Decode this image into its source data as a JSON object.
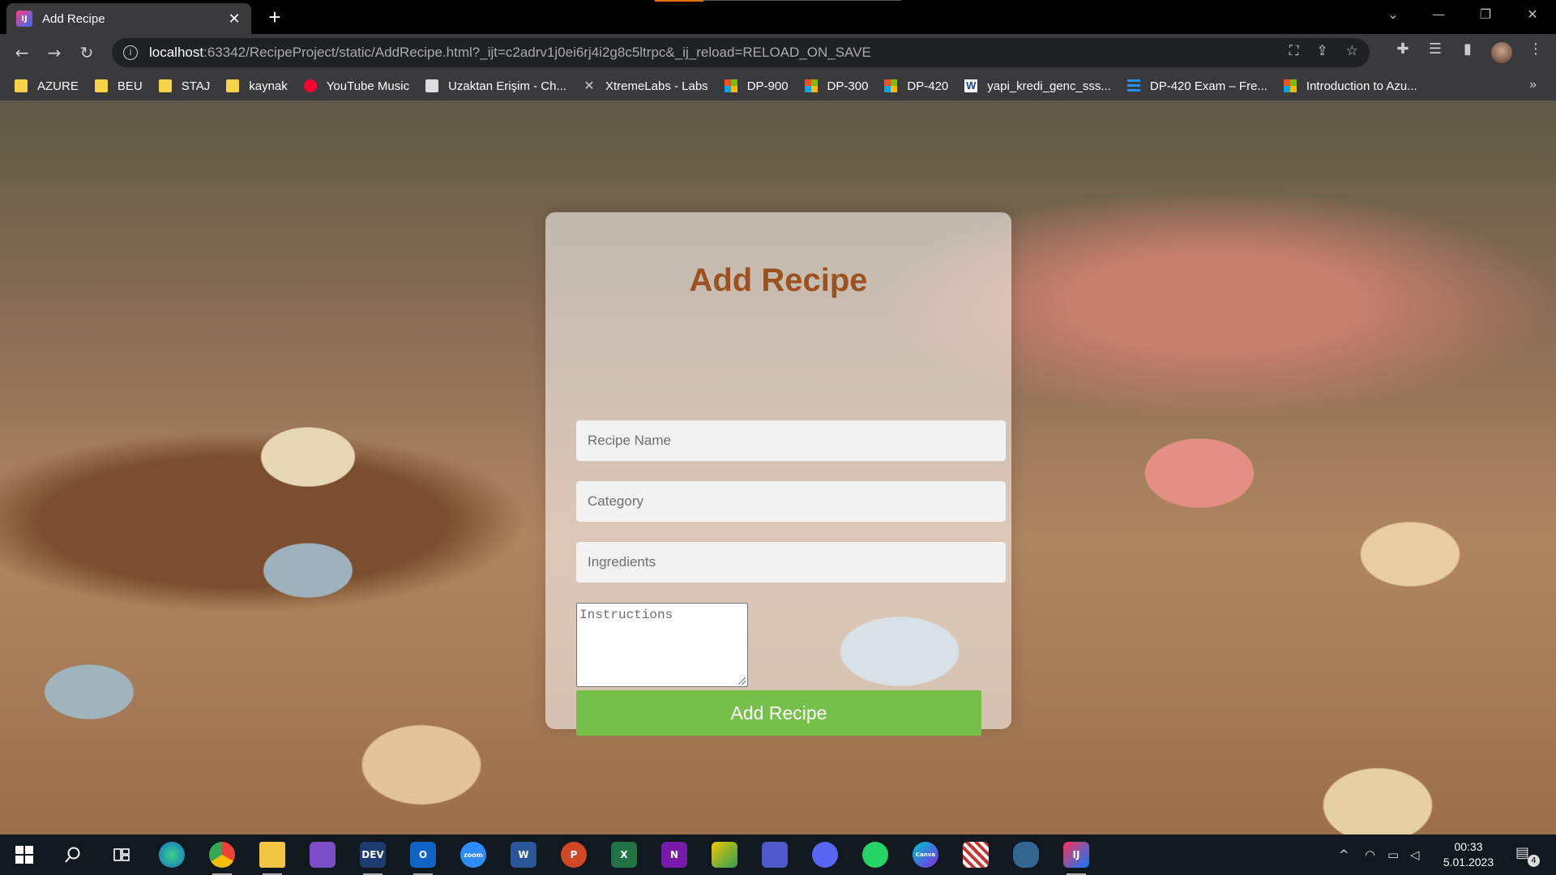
{
  "browser": {
    "tab": {
      "title": "Add Recipe",
      "favicon": "IJ",
      "close": "✕"
    },
    "new_tab": "+",
    "window_controls": {
      "dropdown": "⌄",
      "minimize": "—",
      "restore": "❐",
      "close": "✕"
    },
    "nav": {
      "back": "←",
      "forward": "→",
      "reload": "↻"
    },
    "url": {
      "host": "localhost",
      "rest": ":63342/RecipeProject/static/AddRecipe.html?_ijt=c2adrv1j0ei6rj4i2g8c5ltrpc&_ij_reload=RELOAD_ON_SAVE"
    },
    "omnibox_icons": {
      "translate": "⛶",
      "share": "⇪",
      "bookmark": "☆"
    },
    "toolbar_icons": {
      "extensions": "✚",
      "media": "☰",
      "sidepanel": "▮",
      "menu": "⋮"
    },
    "bookmarks": [
      {
        "label": "AZURE",
        "icon": "folder-icon"
      },
      {
        "label": "BEU",
        "icon": "folder-icon"
      },
      {
        "label": "STAJ",
        "icon": "folder-icon"
      },
      {
        "label": "kaynak",
        "icon": "folder-icon"
      },
      {
        "label": "YouTube Music",
        "icon": "youtube-music-icon"
      },
      {
        "label": "Uzaktan Erişim - Ch...",
        "icon": "remote-desktop-icon"
      },
      {
        "label": "XtremeLabs - Labs",
        "icon": "xtremelabs-icon"
      },
      {
        "label": "DP-900",
        "icon": "microsoft-icon"
      },
      {
        "label": "DP-300",
        "icon": "microsoft-icon"
      },
      {
        "label": "DP-420",
        "icon": "microsoft-icon"
      },
      {
        "label": "yapi_kredi_genc_sss...",
        "icon": "word-icon"
      },
      {
        "label": "DP-420 Exam – Fre...",
        "icon": "exam-icon"
      },
      {
        "label": "Introduction to Azu...",
        "icon": "microsoft-icon"
      }
    ],
    "bookmarks_more": "»"
  },
  "form": {
    "title": "Add Recipe",
    "recipe_name_placeholder": "Recipe Name",
    "category_placeholder": "Category",
    "ingredients_placeholder": "Ingredients",
    "instructions_placeholder": "Instructions",
    "submit_label": "Add Recipe",
    "title_color": "#9b521f",
    "button_color": "#76c04a"
  },
  "taskbar": {
    "apps": [
      "windows-start-icon",
      "search-icon",
      "task-view-icon",
      "edge-icon",
      "chrome-icon",
      "file-explorer-icon",
      "visual-studio-icon",
      "dev-icon",
      "outlook-icon",
      "zoom-icon",
      "word-icon",
      "powerpoint-icon",
      "excel-icon",
      "onenote-icon",
      "snip-icon",
      "teams-icon",
      "discord-icon",
      "whatsapp-icon",
      "canva-icon",
      "game-icon",
      "postgres-icon",
      "intellij-icon"
    ],
    "labels": {
      "dev": "DEV",
      "zoom": "zoom",
      "word": "W",
      "powerpoint": "P",
      "excel": "X",
      "onenote": "N",
      "canva": "Canva",
      "intellij": "IJ",
      "outlook": "O"
    },
    "time": "00:33",
    "date": "5.01.2023",
    "notifications": "4"
  }
}
